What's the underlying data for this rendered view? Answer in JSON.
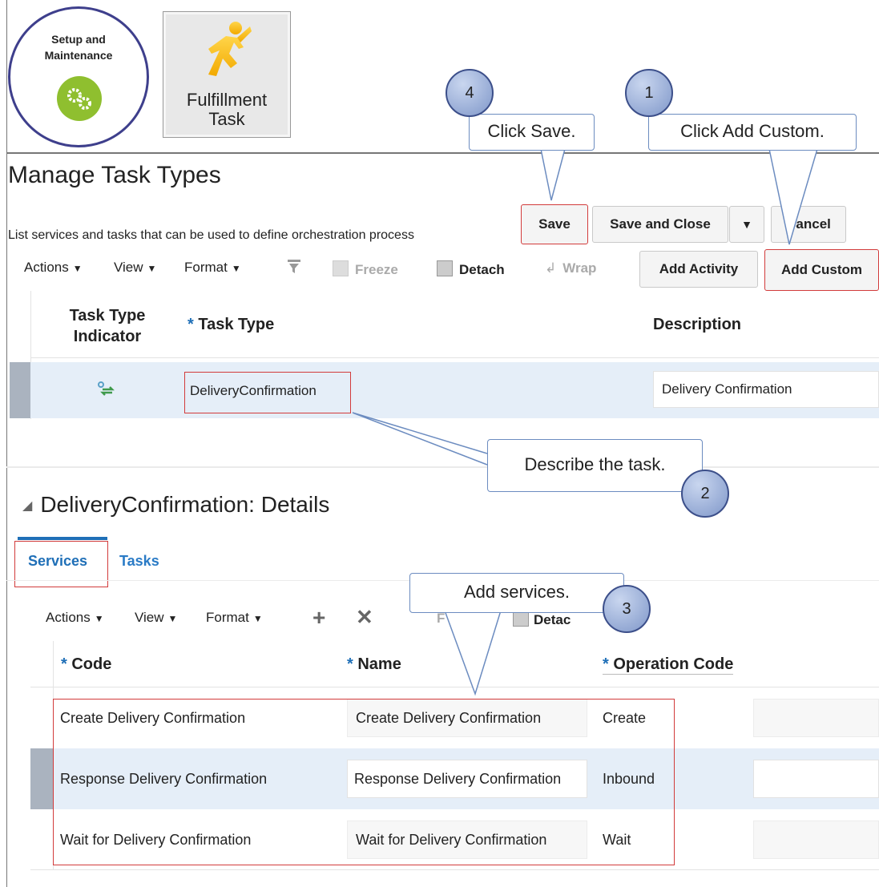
{
  "tiles": {
    "setup_label": "Setup and Maintenance",
    "setup_line1": "Setup and",
    "setup_line2": "Maintenance",
    "fulfillment_line1": "Fulfillment",
    "fulfillment_line2": "Task"
  },
  "callouts": {
    "c1": {
      "num": "1",
      "text": "Click Add Custom."
    },
    "c2": {
      "num": "2",
      "text": "Describe the task."
    },
    "c3": {
      "num": "3",
      "text": "Add services."
    },
    "c4": {
      "num": "4",
      "text": "Click Save."
    }
  },
  "page": {
    "title": "Manage Task Types",
    "subtitle": "List services and tasks that can be used to define orchestration process"
  },
  "header_buttons": {
    "save": "Save",
    "save_close": "Save and Close",
    "cancel": "Cancel"
  },
  "toolbar": {
    "actions": "Actions",
    "view": "View",
    "format": "Format",
    "freeze": "Freeze",
    "detach": "Detach",
    "wrap": "Wrap",
    "add_activity": "Add Activity",
    "add_custom": "Add Custom"
  },
  "task_table": {
    "col_indicator_1": "Task Type",
    "col_indicator_2": "Indicator",
    "col_task_type": "Task Type",
    "col_description": "Description",
    "row": {
      "task_type": "DeliveryConfirmation",
      "description": "Delivery Confirmation"
    }
  },
  "details": {
    "title": "DeliveryConfirmation: Details",
    "tabs": [
      "Services",
      "Tasks"
    ],
    "toolbar": {
      "actions": "Actions",
      "view": "View",
      "format": "Format",
      "freeze_partial": "F",
      "detach_partial": "Detac"
    },
    "columns": {
      "code": "Code",
      "name": "Name",
      "operation_code": "Operation Code"
    },
    "rows": [
      {
        "code": "Create Delivery Confirmation",
        "name": "Create Delivery Confirmation",
        "op": "Create"
      },
      {
        "code": "Response Delivery Confirmation",
        "name": "Response Delivery Confirmation",
        "op": "Inbound"
      },
      {
        "code": "Wait for Delivery Confirmation",
        "name": "Wait for Delivery Confirmation",
        "op": "Wait"
      }
    ]
  },
  "colors": {
    "accent": "#1f6fb7",
    "highlight": "#d23b3b",
    "selected_row": "#e5eef8",
    "gear_green": "#8fbf2f"
  }
}
